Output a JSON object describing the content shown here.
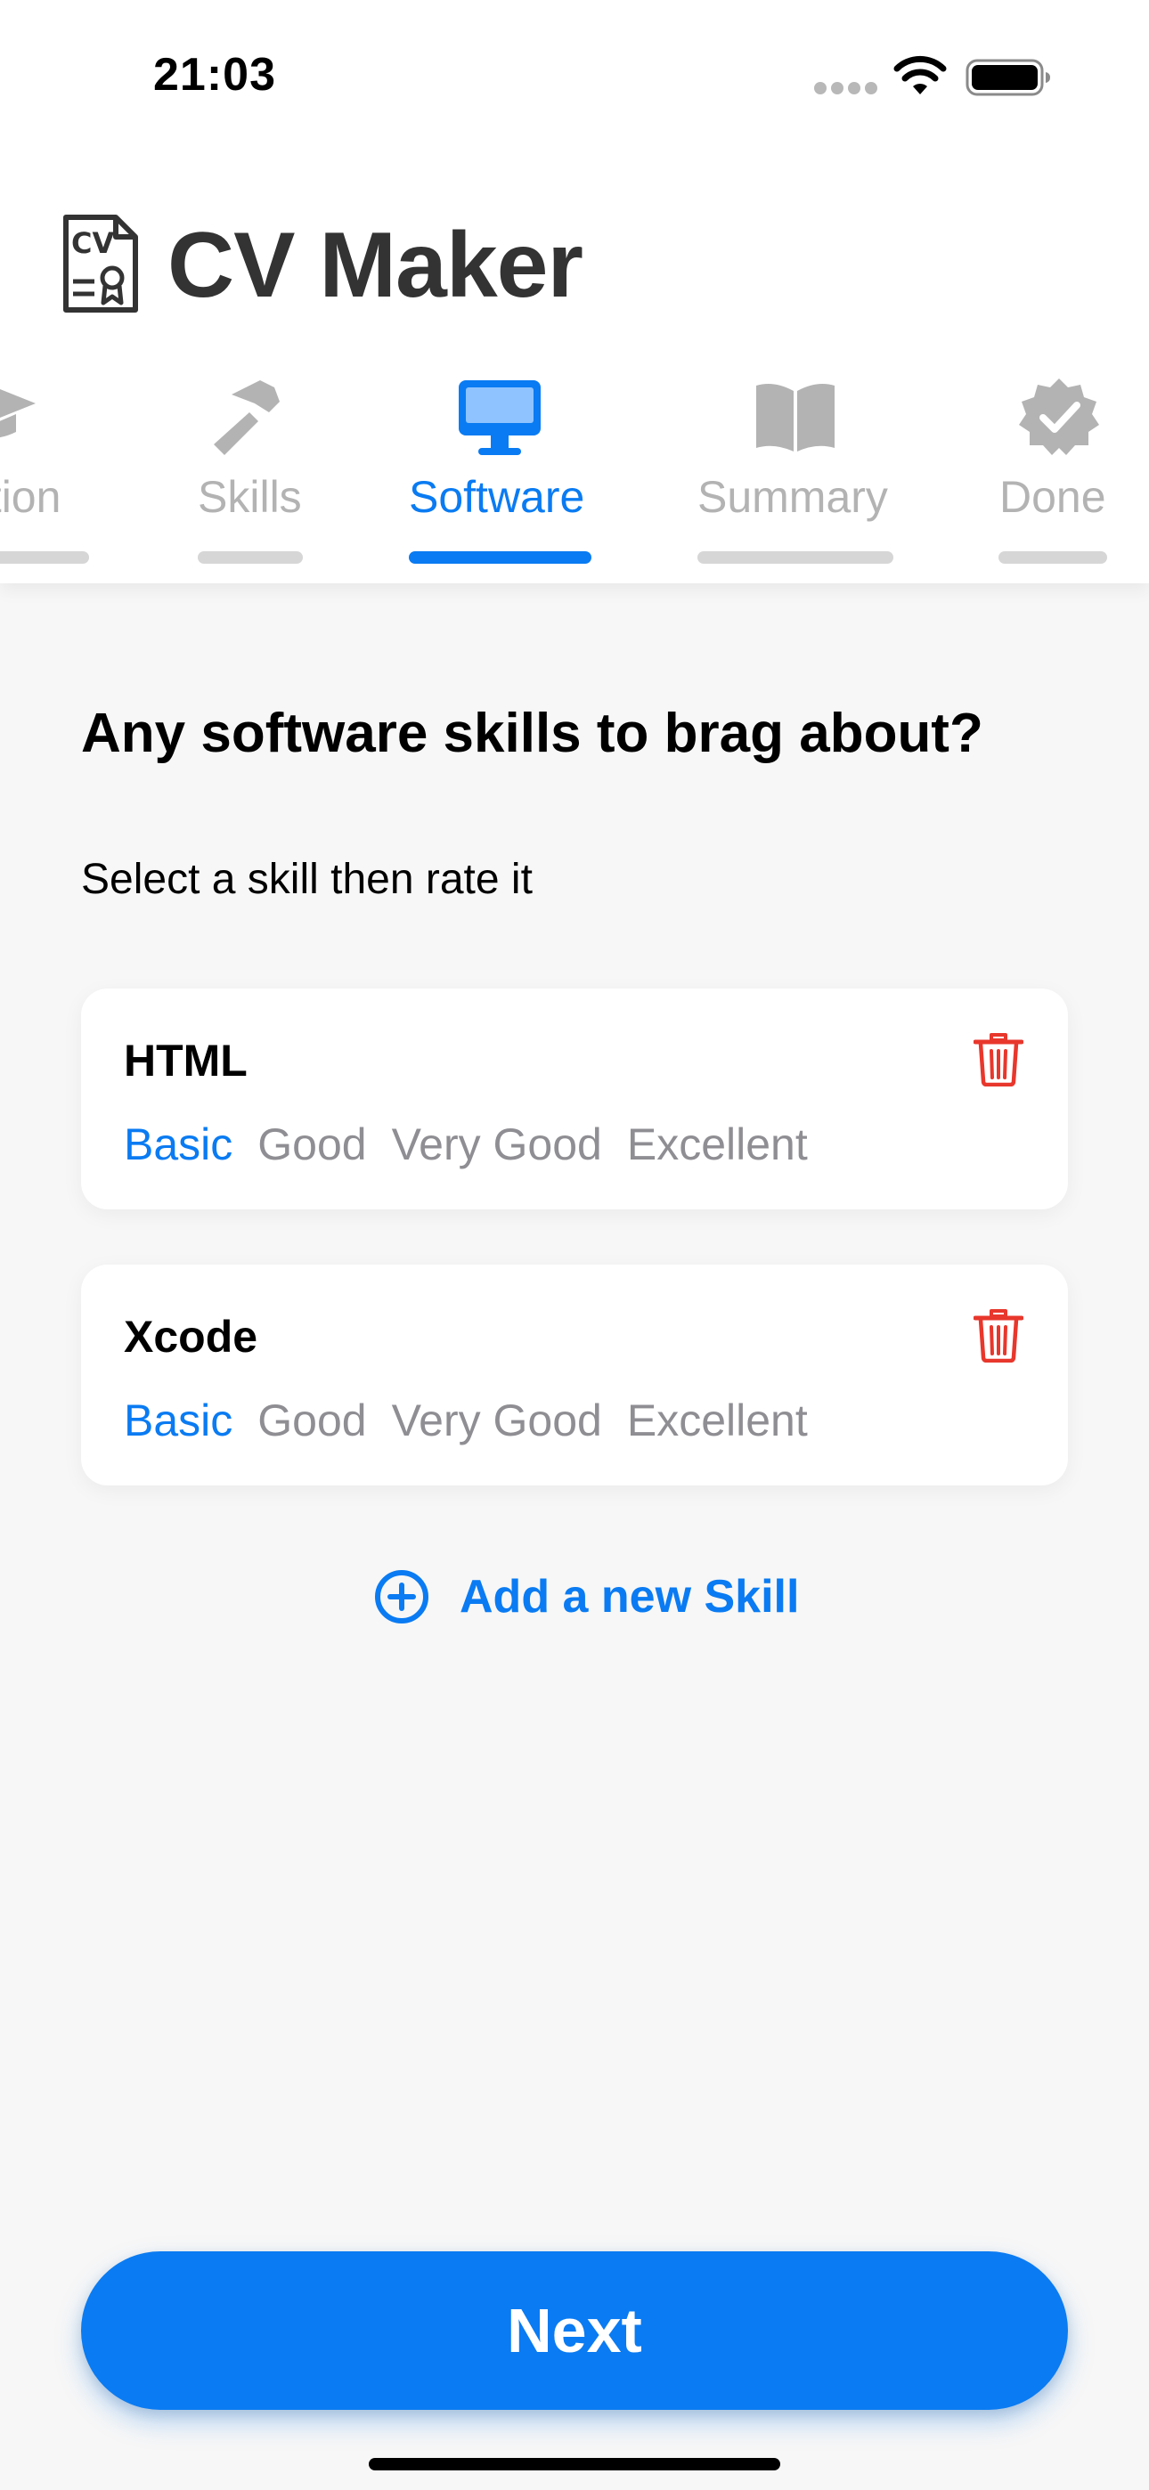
{
  "status_bar": {
    "time": "21:03",
    "wifi_icon": "wifi-icon",
    "battery_icon": "battery-full-icon"
  },
  "app": {
    "title": "CV Maker",
    "logo_icon": "cv-certificate-icon",
    "logo_text": "CV"
  },
  "tabs": [
    {
      "label": "ation",
      "icon": "graduation-cap-icon",
      "active": false
    },
    {
      "label": "Skills",
      "icon": "hammer-icon",
      "active": false
    },
    {
      "label": "Software",
      "icon": "desktop-computer-icon",
      "active": true
    },
    {
      "label": "Summary",
      "icon": "open-book-icon",
      "active": false
    },
    {
      "label": "Done",
      "icon": "checkmark-seal-icon",
      "active": false
    }
  ],
  "main": {
    "question": "Any software skills to brag about?",
    "instruction": "Select a skill then rate it"
  },
  "rating_options": [
    "Basic",
    "Good",
    "Very Good",
    "Excellent"
  ],
  "skills": [
    {
      "name": "HTML",
      "rating": "Basic",
      "delete_icon": "trash-icon"
    },
    {
      "name": "Xcode",
      "rating": "Basic",
      "delete_icon": "trash-icon"
    }
  ],
  "add_skill": {
    "label": "Add a new Skill",
    "icon": "plus-circle-icon"
  },
  "next_button": {
    "label": "Next"
  },
  "colors": {
    "accent": "#0A7BF2",
    "inactive_tab": "#B3B3B3",
    "inactive_bar": "#D6D6D6",
    "rating_inactive": "#8E8E93",
    "delete": "#E8372C",
    "title": "#333333"
  }
}
